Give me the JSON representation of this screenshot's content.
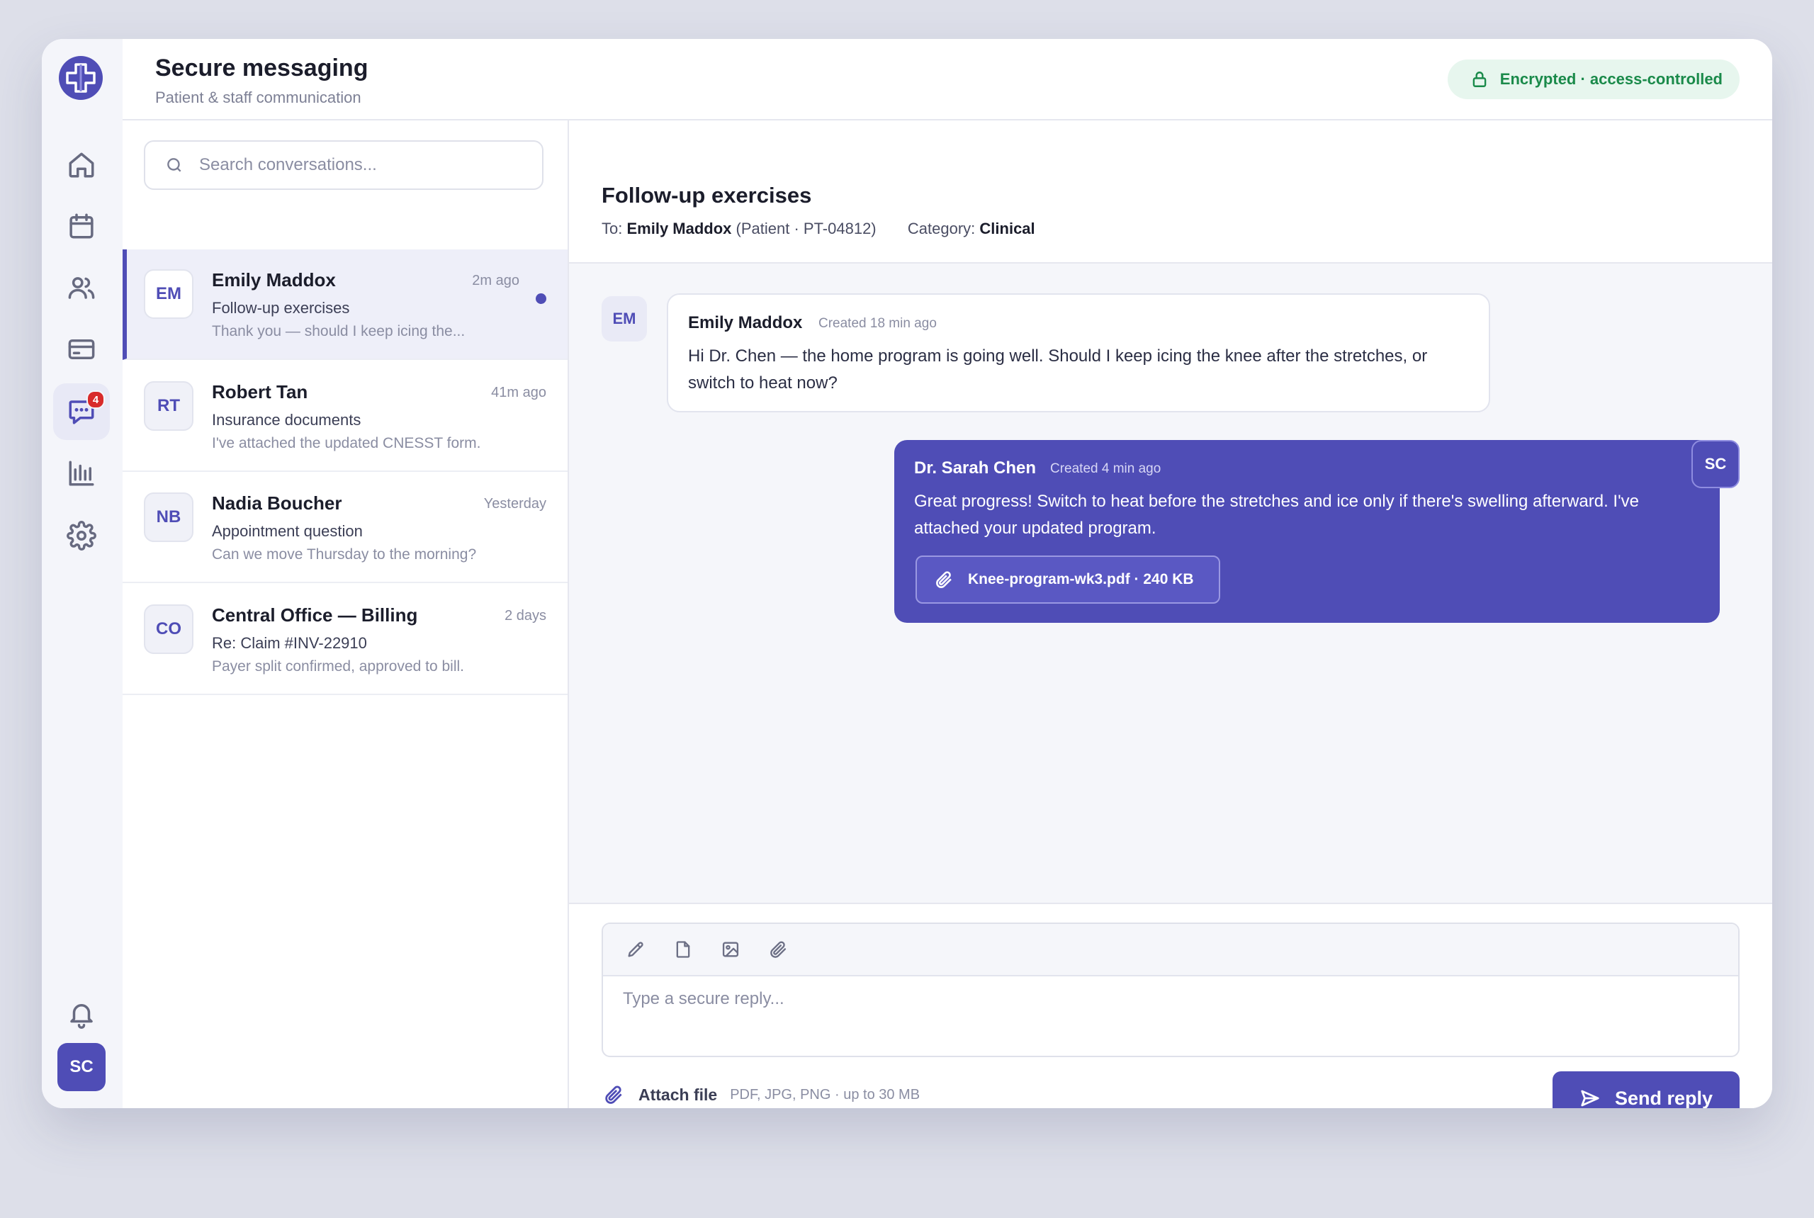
{
  "app": {
    "title": "Secure messaging",
    "subtitle": "Patient & staff communication",
    "security_badge": "Encrypted · access-controlled"
  },
  "rail": {
    "items": [
      {
        "icon": "home-icon"
      },
      {
        "icon": "calendar-icon"
      },
      {
        "icon": "users-icon"
      },
      {
        "icon": "billing-card-icon"
      },
      {
        "icon": "messages-icon",
        "active": true,
        "badge": "4"
      },
      {
        "icon": "analytics-icon"
      },
      {
        "icon": "settings-icon"
      }
    ],
    "notifications_icon": "bell-icon",
    "user_initials": "SC"
  },
  "search": {
    "placeholder": "Search conversations..."
  },
  "conversations": [
    {
      "initials": "EM",
      "name": "Emily Maddox",
      "time": "2m ago",
      "subject": "Follow-up exercises",
      "preview": "Thank you — should I keep icing the...",
      "selected": true,
      "unread": true
    },
    {
      "initials": "RT",
      "name": "Robert Tan",
      "time": "41m ago",
      "subject": "Insurance documents",
      "preview": "I've attached the updated CNESST form."
    },
    {
      "initials": "NB",
      "name": "Nadia Boucher",
      "time": "Yesterday",
      "subject": "Appointment question",
      "preview": "Can we move Thursday to the morning?"
    },
    {
      "initials": "CO",
      "name": "Central Office — Billing",
      "time": "2 days",
      "subject": "Re: Claim #INV-22910",
      "preview": "Payer split confirmed, approved to bill."
    }
  ],
  "thread": {
    "title": "Follow-up exercises",
    "to_label": "To:",
    "to_name": "Emily Maddox",
    "to_detail": "(Patient · PT-04812)",
    "category_label": "Category:",
    "category_value": "Clinical",
    "messages": [
      {
        "direction": "in",
        "initials": "EM",
        "sender": "Emily Maddox",
        "created": "Created 18 min ago",
        "body": "Hi Dr. Chen — the home program is going well. Should I keep icing the knee after the stretches, or switch to heat now?"
      },
      {
        "direction": "out",
        "initials": "SC",
        "sender": "Dr. Sarah Chen",
        "created": "Created 4 min ago",
        "body": "Great progress! Switch to heat before the stretches and ice only if there's swelling afterward. I've attached your updated program.",
        "attachment": "Knee-program-wk3.pdf · 240 KB"
      }
    ]
  },
  "composer": {
    "tools": [
      "pencil-icon",
      "document-icon",
      "image-icon",
      "paperclip-icon"
    ],
    "placeholder": "Type a secure reply...",
    "attach_label": "Attach file",
    "attach_hint": "PDF, JPG, PNG · up to 30 MB",
    "send_label": "Send reply"
  },
  "colors": {
    "accent": "#4f4db6",
    "secure_green": "#1a8a4a",
    "badge_red": "#d82b2b"
  }
}
